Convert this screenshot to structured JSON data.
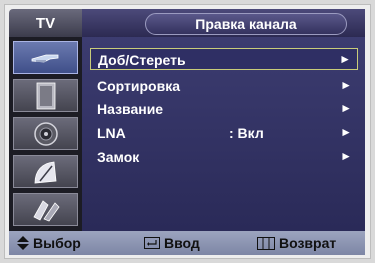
{
  "header": {
    "tv_label": "TV",
    "title": "Правка канала"
  },
  "sidebar": {
    "items": [
      {
        "icon": "antenna-icon",
        "active": true
      },
      {
        "icon": "picture-icon",
        "active": false
      },
      {
        "icon": "sound-icon",
        "active": false
      },
      {
        "icon": "channel-icon",
        "active": false
      },
      {
        "icon": "setup-icon",
        "active": false
      }
    ]
  },
  "menu": {
    "items": [
      {
        "label": "Доб/Стереть",
        "value": "",
        "arrow": "►",
        "selected": true
      },
      {
        "label": "Сортировка",
        "value": "",
        "arrow": "►",
        "selected": false
      },
      {
        "label": "Название",
        "value": "",
        "arrow": "►",
        "selected": false
      },
      {
        "label": "LNA",
        "value": ":  Вкл",
        "arrow": "►",
        "selected": false
      },
      {
        "label": "Замок",
        "value": "",
        "arrow": "►",
        "selected": false
      }
    ]
  },
  "footer": {
    "move": "Выбор",
    "enter": "Ввод",
    "return": "Возврат"
  },
  "colors": {
    "selection_border": "#c9cc7a",
    "menu_bg": "#2a2a58",
    "footer_bg": "#8f97b4"
  }
}
